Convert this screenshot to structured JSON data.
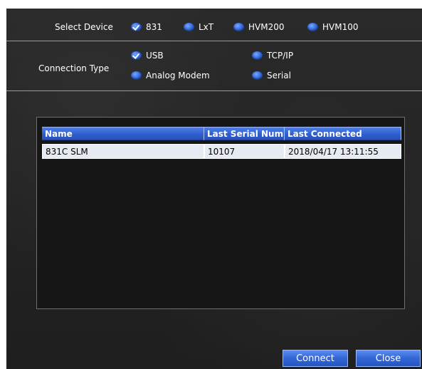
{
  "select_device": {
    "label": "Select Device",
    "options": [
      {
        "label": "831",
        "checked": true
      },
      {
        "label": "LxT",
        "checked": false
      },
      {
        "label": "HVM200",
        "checked": false
      },
      {
        "label": "HVM100",
        "checked": false
      }
    ]
  },
  "connection_type": {
    "label": "Connection Type",
    "options": [
      {
        "label": "USB",
        "checked": true
      },
      {
        "label": "TCP/IP",
        "checked": false
      },
      {
        "label": "Analog Modem",
        "checked": false
      },
      {
        "label": "Serial",
        "checked": false
      }
    ]
  },
  "device_table": {
    "columns": [
      "Name",
      "Last Serial Num",
      "Last Connected"
    ],
    "rows": [
      [
        "831C SLM",
        "10107",
        "2018/04/17  13:11:55"
      ]
    ]
  },
  "buttons": {
    "connect": "Connect",
    "close": "Close"
  },
  "colors": {
    "accent": "#3366d6",
    "background": "#242424"
  }
}
